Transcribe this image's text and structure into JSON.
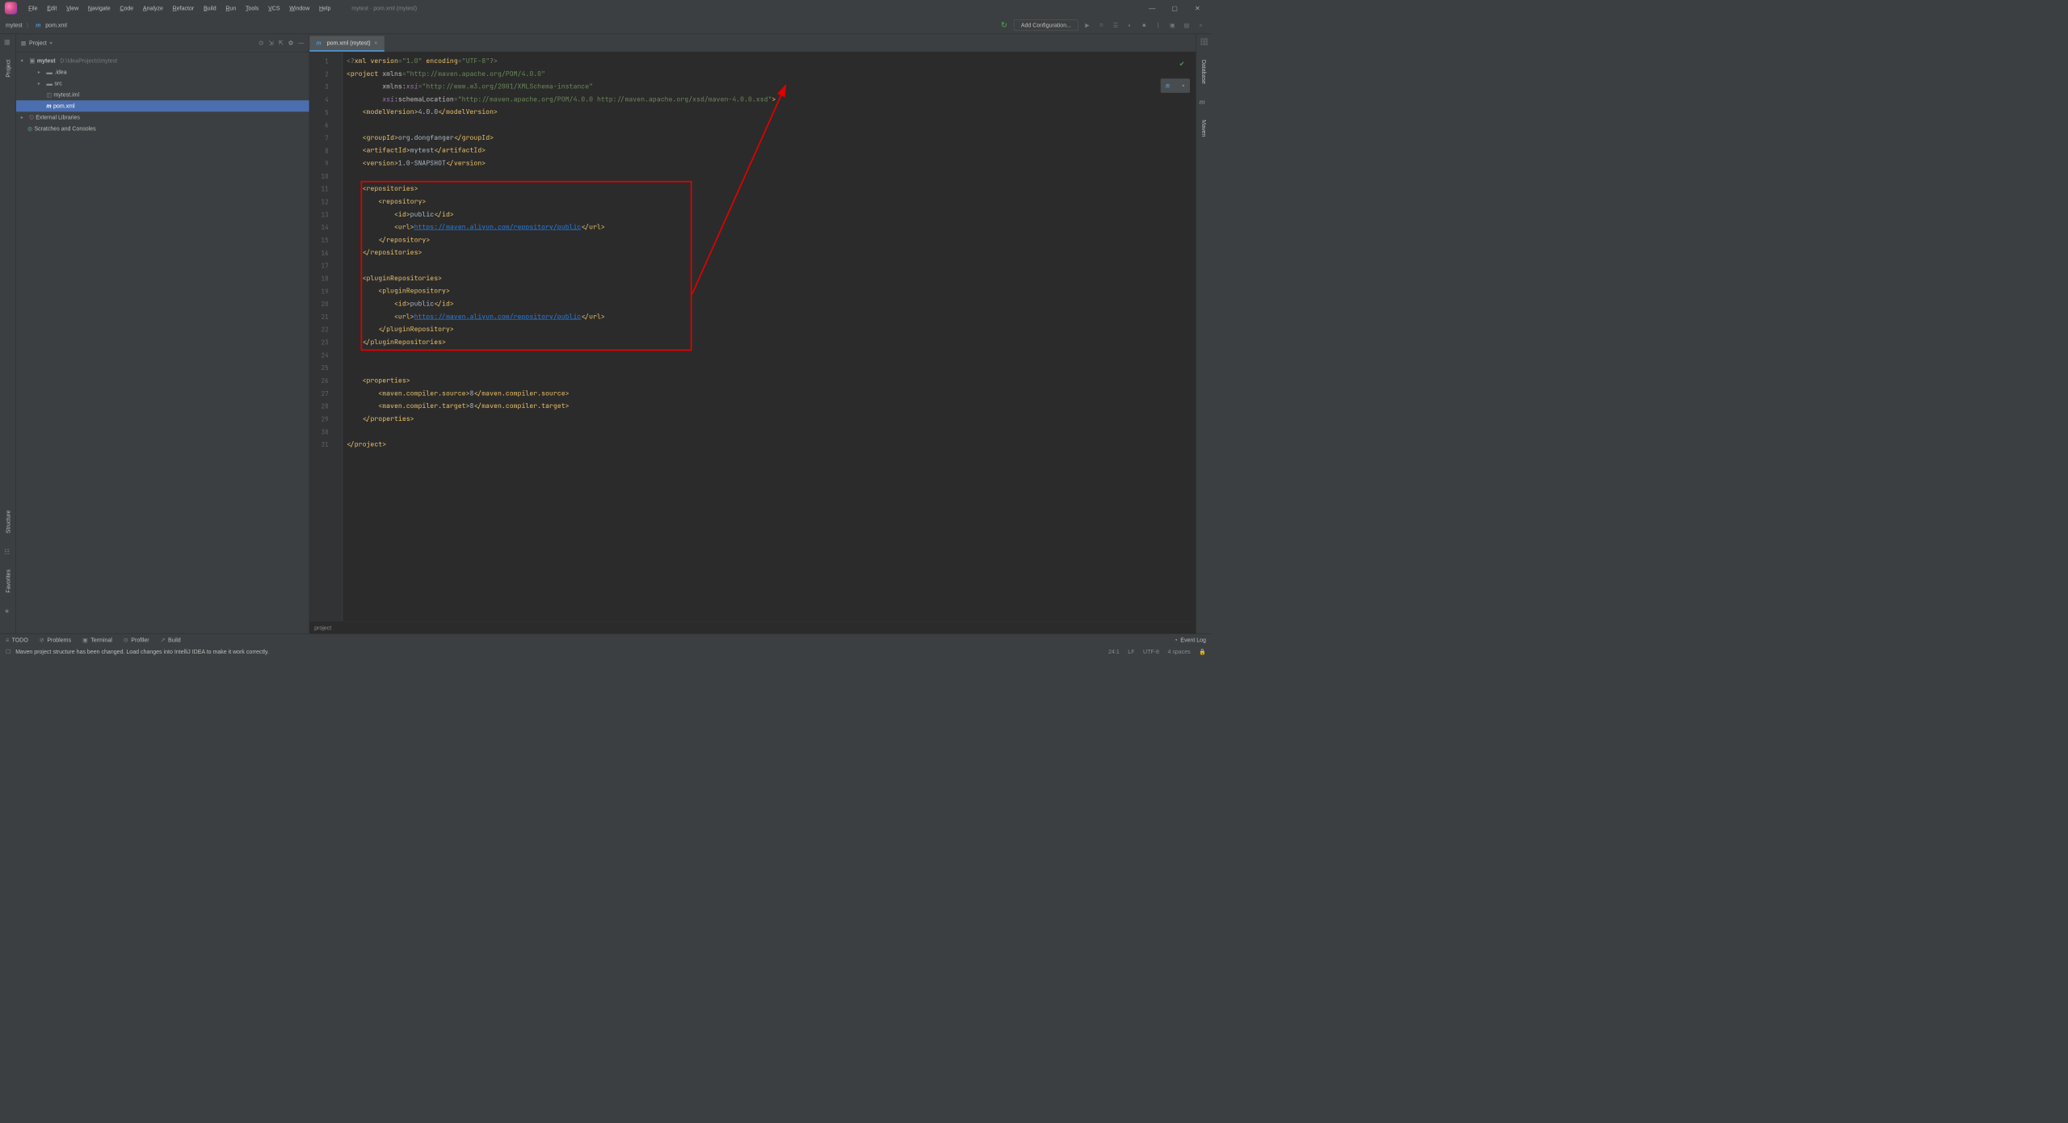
{
  "menubar": [
    "File",
    "Edit",
    "View",
    "Navigate",
    "Code",
    "Analyze",
    "Refactor",
    "Build",
    "Run",
    "Tools",
    "VCS",
    "Window",
    "Help"
  ],
  "window_title": "mytest · pom.xml (mytest)",
  "breadcrumb": {
    "project": "mytest",
    "file": "pom.xml"
  },
  "nav": {
    "add_configuration": "Add Configuration..."
  },
  "project_panel": {
    "title": "Project",
    "root": {
      "name": "mytest",
      "path": "D:\\IdeaProjects\\mytest"
    },
    "items": [
      {
        "icon": "folder",
        "label": ".idea",
        "indent": 2,
        "chev": "▸"
      },
      {
        "icon": "folder",
        "label": "src",
        "indent": 2,
        "chev": "▸"
      },
      {
        "icon": "file",
        "label": "mytest.iml",
        "indent": 2,
        "chev": ""
      },
      {
        "icon": "m",
        "label": "pom.xml",
        "indent": 2,
        "chev": "",
        "selected": true
      }
    ],
    "external": "External Libraries",
    "scratches": "Scratches and Consoles"
  },
  "editor": {
    "tab": "pom.xml (mytest)",
    "breadcrumb_bottom": "project",
    "lines": 31,
    "code_lines": [
      {
        "html": "<span class='gy'>&lt;?</span><span class='t'>xml version</span><span class='s'>=\"1.0\" </span><span class='t'>encoding</span><span class='s'>=\"UTF-8\"</span><span class='gy'>?&gt;</span>"
      },
      {
        "html": "<span class='t'>&lt;project </span><span class='a'>xmlns</span><span class='s'>=\"http://maven.apache.org/POM/4.0.0\"</span>"
      },
      {
        "html": "         <span class='a'>xmlns:</span><span class='n'>xsi</span><span class='s'>=\"http://www.w3.org/2001/XMLSchema-instance\"</span>"
      },
      {
        "html": "         <span class='n'>xsi</span><span class='a'>:schemaLocation</span><span class='s'>=\"http://maven.apache.org/POM/4.0.0 http://maven.apache.org/xsd/maven-4.0.0.xsd\"</span><span class='t'>&gt;</span>"
      },
      {
        "html": "    <span class='t'>&lt;modelVersion&gt;</span>4.0.0<span class='t'>&lt;/modelVersion&gt;</span>"
      },
      {
        "html": ""
      },
      {
        "html": "    <span class='t'>&lt;groupId&gt;</span>org.dongfanger<span class='t'>&lt;/groupId&gt;</span>"
      },
      {
        "html": "    <span class='t'>&lt;artifactId&gt;</span>mytest<span class='t'>&lt;/artifactId&gt;</span>"
      },
      {
        "html": "    <span class='t'>&lt;version&gt;</span>1.0-SNAPSHOT<span class='t'>&lt;/version&gt;</span>"
      },
      {
        "html": ""
      },
      {
        "html": "    <span class='t'>&lt;repositories&gt;</span>"
      },
      {
        "html": "        <span class='t'>&lt;repository&gt;</span>"
      },
      {
        "html": "            <span class='t'>&lt;id&gt;</span>public<span class='t'>&lt;/id&gt;</span>"
      },
      {
        "html": "            <span class='t'>&lt;url&gt;</span><span class='u'>https://maven.aliyun.com/repository/public</span><span class='t'>&lt;/url&gt;</span>"
      },
      {
        "html": "        <span class='t'>&lt;/repository&gt;</span>"
      },
      {
        "html": "    <span class='t'>&lt;/repositories&gt;</span>"
      },
      {
        "html": ""
      },
      {
        "html": "    <span class='t'>&lt;pluginRepositories&gt;</span>"
      },
      {
        "html": "        <span class='t'>&lt;pluginRepository&gt;</span>"
      },
      {
        "html": "            <span class='t'>&lt;id&gt;</span>public<span class='t'>&lt;/id&gt;</span>"
      },
      {
        "html": "            <span class='t'>&lt;url&gt;</span><span class='u'>https://maven.aliyun.com/repository/public</span><span class='t'>&lt;/url&gt;</span>"
      },
      {
        "html": "        <span class='t'>&lt;/pluginRepository&gt;</span>"
      },
      {
        "html": "    <span class='t'>&lt;/pluginRepositories&gt;</span>"
      },
      {
        "html": ""
      },
      {
        "html": ""
      },
      {
        "html": "    <span class='t'>&lt;properties&gt;</span>"
      },
      {
        "html": "        <span class='t'>&lt;maven.compiler.source&gt;</span>8<span class='t'>&lt;/maven.compiler.source&gt;</span>"
      },
      {
        "html": "        <span class='t'>&lt;maven.compiler.target&gt;</span>8<span class='t'>&lt;/maven.compiler.target&gt;</span>"
      },
      {
        "html": "    <span class='t'>&lt;/properties&gt;</span>"
      },
      {
        "html": ""
      },
      {
        "html": "<span class='t'>&lt;/project&gt;</span>"
      }
    ]
  },
  "left_rail": {
    "project": "Project",
    "structure": "Structure",
    "favorites": "Favorites"
  },
  "right_rail": {
    "database": "Database",
    "maven": "Maven"
  },
  "status": {
    "items": [
      "TODO",
      "Problems",
      "Terminal",
      "Profiler",
      "Build"
    ],
    "event": "Event Log"
  },
  "bottom": {
    "msg": "Maven project structure has been changed. Load changes into IntelliJ IDEA to make it work correctly.",
    "cursor": "24:1",
    "lf": "LF",
    "enc": "UTF-8",
    "spaces": "4 spaces"
  }
}
